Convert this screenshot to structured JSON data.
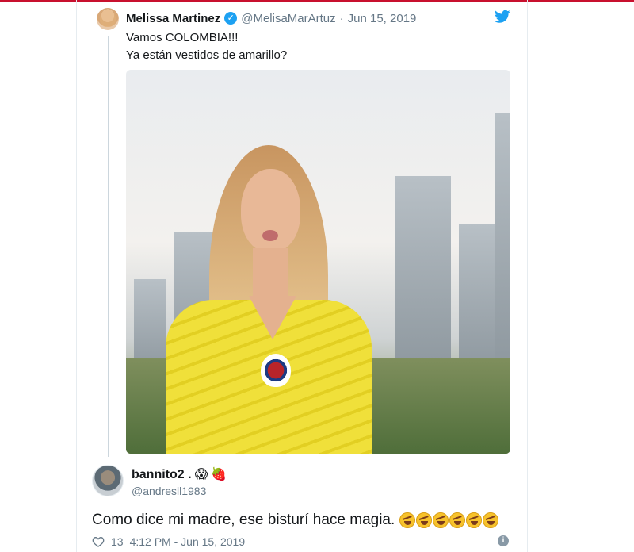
{
  "quoted_tweet": {
    "author_name": "Melissa Martinez",
    "handle": "@MelisaMarArtuz",
    "separator": "·",
    "date": "Jun 15, 2019",
    "text_lines": [
      "Vamos COLOMBIA!!!",
      "Ya están vestidos de amarillo?"
    ],
    "verified_icon": "check",
    "media": "photo of woman in yellow Colombia jersey"
  },
  "reply": {
    "author_name": "bannito2 .",
    "name_emoji": [
      "😱",
      "🍓"
    ],
    "handle": "@andresll1983",
    "text": "Como dice mi madre, ese bisturí hace magia.",
    "laugh_emoji_count": 6,
    "likes": "13",
    "time": "4:12 PM - Jun 15, 2019"
  },
  "colors": {
    "accent": "#1da1f2",
    "top_bar": "#c8102e",
    "muted": "#657786"
  },
  "icons": [
    "twitter-bird-icon",
    "verified-icon",
    "heart-icon",
    "info-icon"
  ]
}
